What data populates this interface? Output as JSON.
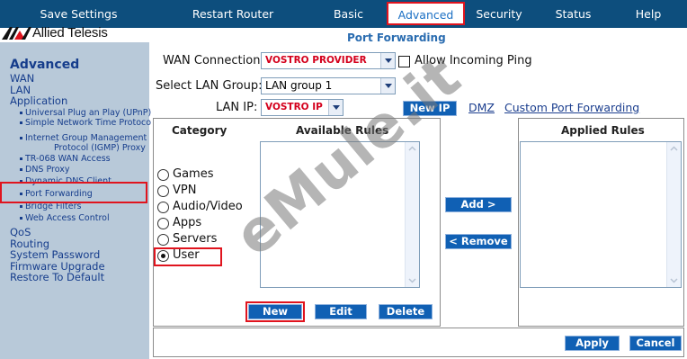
{
  "nav": {
    "save_settings": "Save Settings",
    "restart_router": "Restart Router",
    "basic": "Basic",
    "advanced": "Advanced",
    "security": "Security",
    "status": "Status",
    "help": "Help"
  },
  "brand": {
    "logo_text": "Allied Telesis",
    "logo_color": "#111111"
  },
  "page_title": "Port Forwarding",
  "sidebar": {
    "section_title": "Advanced",
    "wan": "WAN",
    "lan": "LAN",
    "application": "Application",
    "app_items": [
      "Universal Plug an Play (UPnP)",
      "Simple Network Time Protoco",
      "Internet Group Management",
      "Protocol (IGMP) Proxy",
      "TR-068 WAN Access",
      "DNS Proxy",
      "Dynamic DNS Client",
      "Port Forwarding",
      "Bridge Filters",
      "Web Access Control"
    ],
    "qos": "QoS",
    "routing": "Routing",
    "system_password": "System Password",
    "firmware_upgrade": "Firmware Upgrade",
    "restore_default": "Restore To Default"
  },
  "form": {
    "wan_label": "WAN Connection:",
    "wan_value": "VOSTRO PROVIDER",
    "allow_ping": "Allow Incoming Ping",
    "lan_group_label": "Select LAN Group:",
    "lan_group_value": "LAN group 1",
    "lan_ip_label": "LAN IP:",
    "lan_ip_value": "VOSTRO IP",
    "new_ip": "New IP",
    "dmz": "DMZ",
    "custom_pf": "Custom Port Forwarding"
  },
  "rules": {
    "category_head": "Category",
    "available_head": "Available Rules",
    "applied_head": "Applied Rules",
    "categories": [
      "Games",
      "VPN",
      "Audio/Video",
      "Apps",
      "Servers",
      "User"
    ],
    "selected": "User",
    "add": "Add >",
    "remove": "< Remove",
    "new": "New",
    "edit": "Edit",
    "delete": "Delete"
  },
  "footer": {
    "apply": "Apply",
    "cancel": "Cancel"
  },
  "watermark": "eMule.it",
  "colors": {
    "nav_bg": "#0d4e7d",
    "sidebar_bg": "#b8c9d9",
    "button_bg": "#1060b4",
    "highlight": "#e0141e"
  }
}
